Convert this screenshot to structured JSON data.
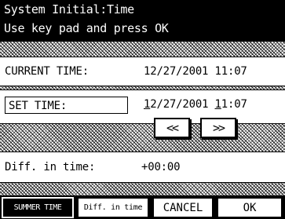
{
  "header": {
    "title": "System Initial:Time",
    "instruction": "Use key pad and press OK"
  },
  "current_time": {
    "label": "CURRENT TIME:",
    "value": "12/27/2001 11:07"
  },
  "set_time": {
    "label": "SET TIME:",
    "value_pre": "",
    "value_cursor_a": "1",
    "value_mid": "2/27/2001 ",
    "value_cursor_b": "1",
    "value_post": "1:07"
  },
  "arrows": {
    "left": "<<",
    "right": ">>"
  },
  "diff": {
    "label": "Diff. in time:",
    "value": "+00:00"
  },
  "footer": {
    "summer_time": "SUMMER TIME",
    "diff_in_time": "Diff. in time",
    "cancel": "CANCEL",
    "ok": "OK"
  }
}
